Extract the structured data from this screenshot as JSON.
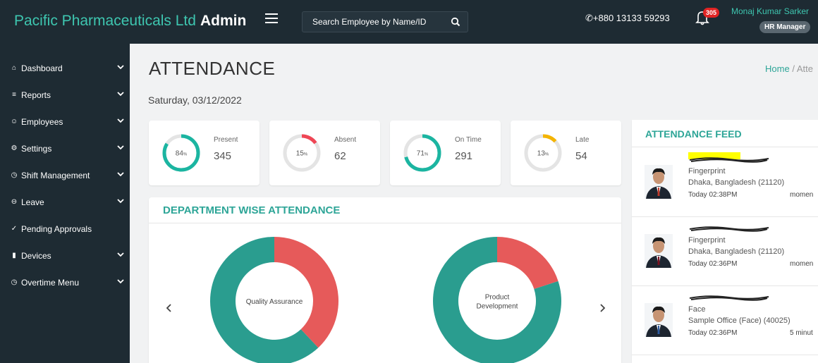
{
  "header": {
    "brand": "Pacific Pharmaceuticals Ltd",
    "brand_bold": "Admin",
    "search_placeholder": "Search Employee by Name/ID",
    "phone": "+880 13133 59293",
    "notification_count": "305",
    "user_name": "Monaj Kumar Sarker",
    "user_role": "HR Manager"
  },
  "sidebar": {
    "items": [
      {
        "label": "Dashboard",
        "icon": "home-icon"
      },
      {
        "label": "Reports",
        "icon": "report-icon"
      },
      {
        "label": "Employees",
        "icon": "users-icon"
      },
      {
        "label": "Settings",
        "icon": "settings-icon"
      },
      {
        "label": "Shift Management",
        "icon": "clock-icon"
      },
      {
        "label": "Leave",
        "icon": "minus-circle-icon"
      },
      {
        "label": "Pending Approvals",
        "icon": "check-circle-icon"
      },
      {
        "label": "Devices",
        "icon": "device-icon"
      },
      {
        "label": "Overtime Menu",
        "icon": "clock-icon"
      }
    ]
  },
  "page": {
    "title": "ATTENDANCE",
    "breadcrumb_home": "Home",
    "breadcrumb_sep": "/",
    "breadcrumb_current": "Atte",
    "date": "Saturday, 03/12/2022"
  },
  "stats": [
    {
      "label": "Present",
      "value": "345",
      "percent": "84",
      "fraction": 0.84,
      "color": "#1bb5a1"
    },
    {
      "label": "Absent",
      "value": "62",
      "percent": "15",
      "fraction": 0.15,
      "color": "#ef4655"
    },
    {
      "label": "On Time",
      "value": "291",
      "percent": "71",
      "fraction": 0.71,
      "color": "#1bb5a1"
    },
    {
      "label": "Late",
      "value": "54",
      "percent": "13",
      "fraction": 0.13,
      "color": "#f4b400"
    }
  ],
  "stat_percent_suffix": "%",
  "department": {
    "title": "DEPARTMENT WISE ATTENDANCE",
    "charts": [
      {
        "label": "Quality Assurance",
        "present": 0.62,
        "absent": 0.38
      },
      {
        "label": "Product Development",
        "present": 0.8,
        "absent": 0.2
      }
    ],
    "colors": {
      "present": "#2a9d8f",
      "absent": "#e65a5a"
    }
  },
  "feed": {
    "title": "ATTENDANCE FEED",
    "items": [
      {
        "method": "Fingerprint",
        "location": "Dhaka, Bangladesh (21120)",
        "time": "Today 02:38PM",
        "ago": "momen"
      },
      {
        "method": "Fingerprint",
        "location": "Dhaka, Bangladesh (21120)",
        "time": "Today 02:36PM",
        "ago": "momen"
      },
      {
        "method": "Face",
        "location": "Sample Office (Face) (40025)",
        "time": "Today 02:36PM",
        "ago": "5 minut"
      }
    ]
  }
}
